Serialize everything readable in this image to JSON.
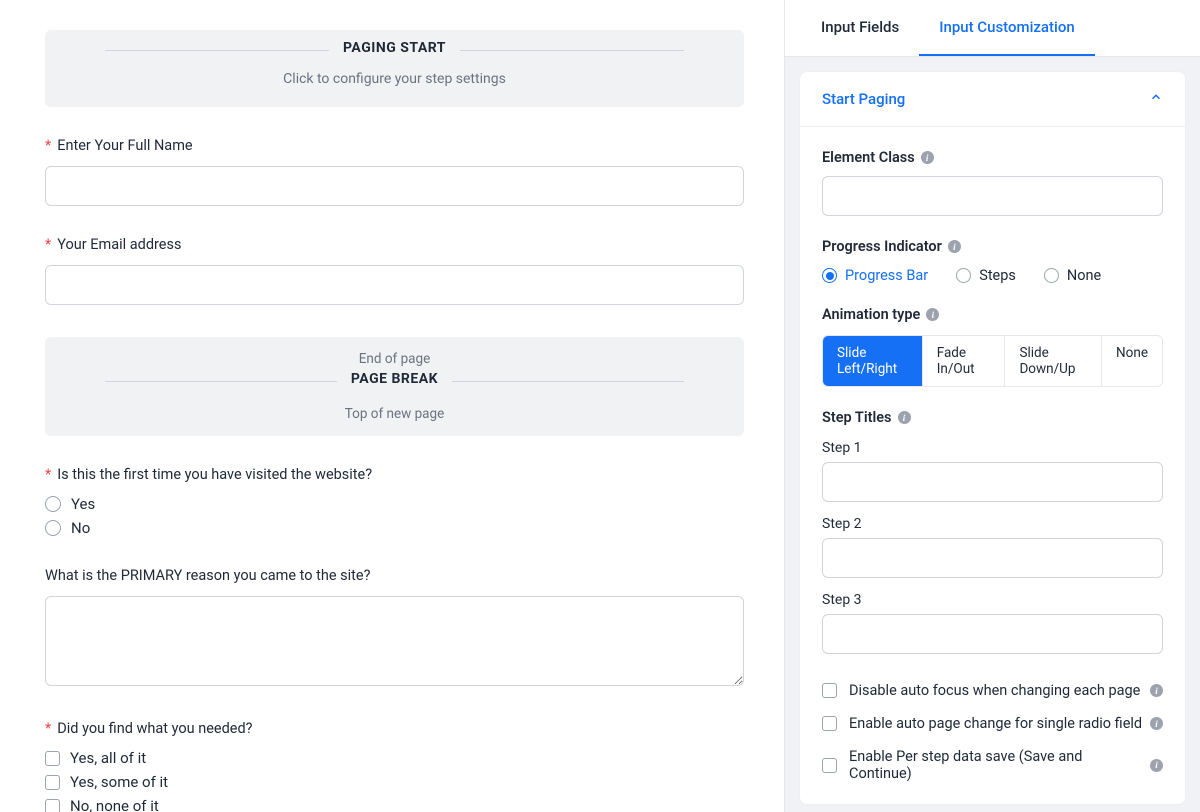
{
  "main": {
    "paging_start": {
      "title": "PAGING START",
      "subtitle": "Click to configure your step settings"
    },
    "fields": {
      "full_name": {
        "label": "Enter Your Full Name",
        "required": true
      },
      "email": {
        "label": "Your Email address",
        "required": true
      }
    },
    "page_break": {
      "top_sub": "End of page",
      "title": "PAGE BREAK",
      "bottom_sub": "Top of new page"
    },
    "first_visit": {
      "label": "Is this the first time you have visited the website?",
      "required": true,
      "options": [
        "Yes",
        "No"
      ]
    },
    "primary_reason": {
      "label": "What is the PRIMARY reason you came to the site?"
    },
    "find_needed": {
      "label": "Did you find what you needed?",
      "required": true,
      "options": [
        "Yes, all of it",
        "Yes, some of it",
        "No, none of it"
      ]
    }
  },
  "sidebar": {
    "tabs": {
      "input_fields": "Input Fields",
      "input_customization": "Input Customization"
    },
    "panel": {
      "title": "Start Paging",
      "element_class": "Element Class",
      "progress_indicator": {
        "label": "Progress Indicator",
        "options": {
          "progress_bar": "Progress Bar",
          "steps": "Steps",
          "none": "None"
        }
      },
      "animation_type": {
        "label": "Animation type",
        "options": {
          "slide_lr": "Slide Left/Right",
          "fade": "Fade In/Out",
          "slide_du": "Slide Down/Up",
          "none": "None"
        }
      },
      "step_titles": {
        "label": "Step Titles",
        "step1": "Step 1",
        "step2": "Step 2",
        "step3": "Step 3"
      },
      "checks": {
        "disable_autofocus": "Disable auto focus when changing each page",
        "enable_autopage": "Enable auto page change for single radio field",
        "enable_perstep": "Enable Per step data save (Save and Continue)"
      }
    }
  }
}
